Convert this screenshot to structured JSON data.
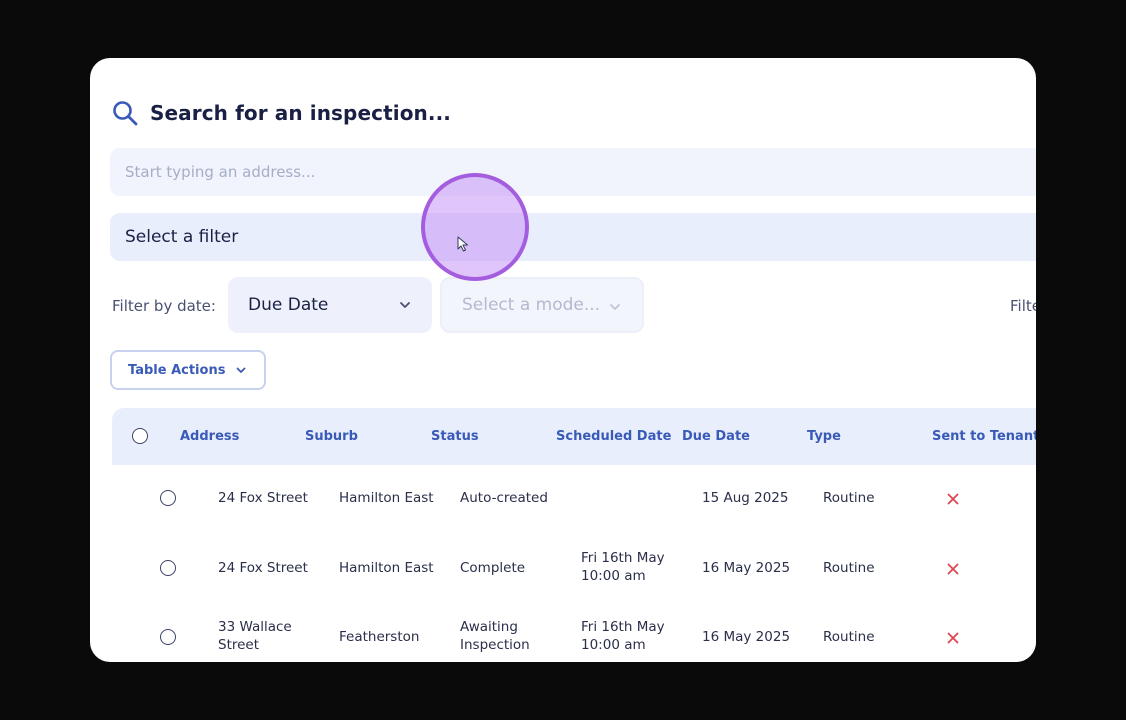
{
  "search": {
    "title": "Search for an inspection...",
    "placeholder": "Start typing an address...",
    "value": ""
  },
  "filter": {
    "selected": "Select a filter"
  },
  "date_filter": {
    "label": "Filter by date:",
    "date_field": "Due Date",
    "mode_placeholder": "Select a mode...",
    "right_label_partial": "Filte"
  },
  "table_actions": {
    "label": "Table Actions"
  },
  "table": {
    "columns": [
      "Address",
      "Suburb",
      "Status",
      "Scheduled Date",
      "Due Date",
      "Type",
      "Sent to Tenant"
    ],
    "rows": [
      {
        "address": [
          "24 Fox Street"
        ],
        "suburb": "Hamilton East",
        "status": [
          "Auto-created"
        ],
        "scheduled": [],
        "due": "15 Aug 2025",
        "type": "Routine",
        "sent_to_tenant": "no"
      },
      {
        "address": [
          "24 Fox Street"
        ],
        "suburb": "Hamilton East",
        "status": [
          "Complete"
        ],
        "scheduled": [
          "Fri 16th May",
          "10:00 am"
        ],
        "due": "16 May 2025",
        "type": "Routine",
        "sent_to_tenant": "no"
      },
      {
        "address": [
          "33 Wallace",
          "Street"
        ],
        "suburb": "Featherston",
        "status": [
          "Awaiting",
          "Inspection"
        ],
        "scheduled": [
          "Fri 16th May",
          "10:00 am"
        ],
        "due": "16 May 2025",
        "type": "Routine",
        "sent_to_tenant": "no"
      }
    ]
  },
  "colors": {
    "accent": "#3a5ab8",
    "cursor_highlight": "#a45ddf",
    "x_mark": "#e0464f"
  },
  "icons": {
    "search": "search-icon",
    "dropdown": "chevron-down-icon",
    "not_sent": "x-mark-icon",
    "pointer": "mouse-pointer-icon"
  }
}
